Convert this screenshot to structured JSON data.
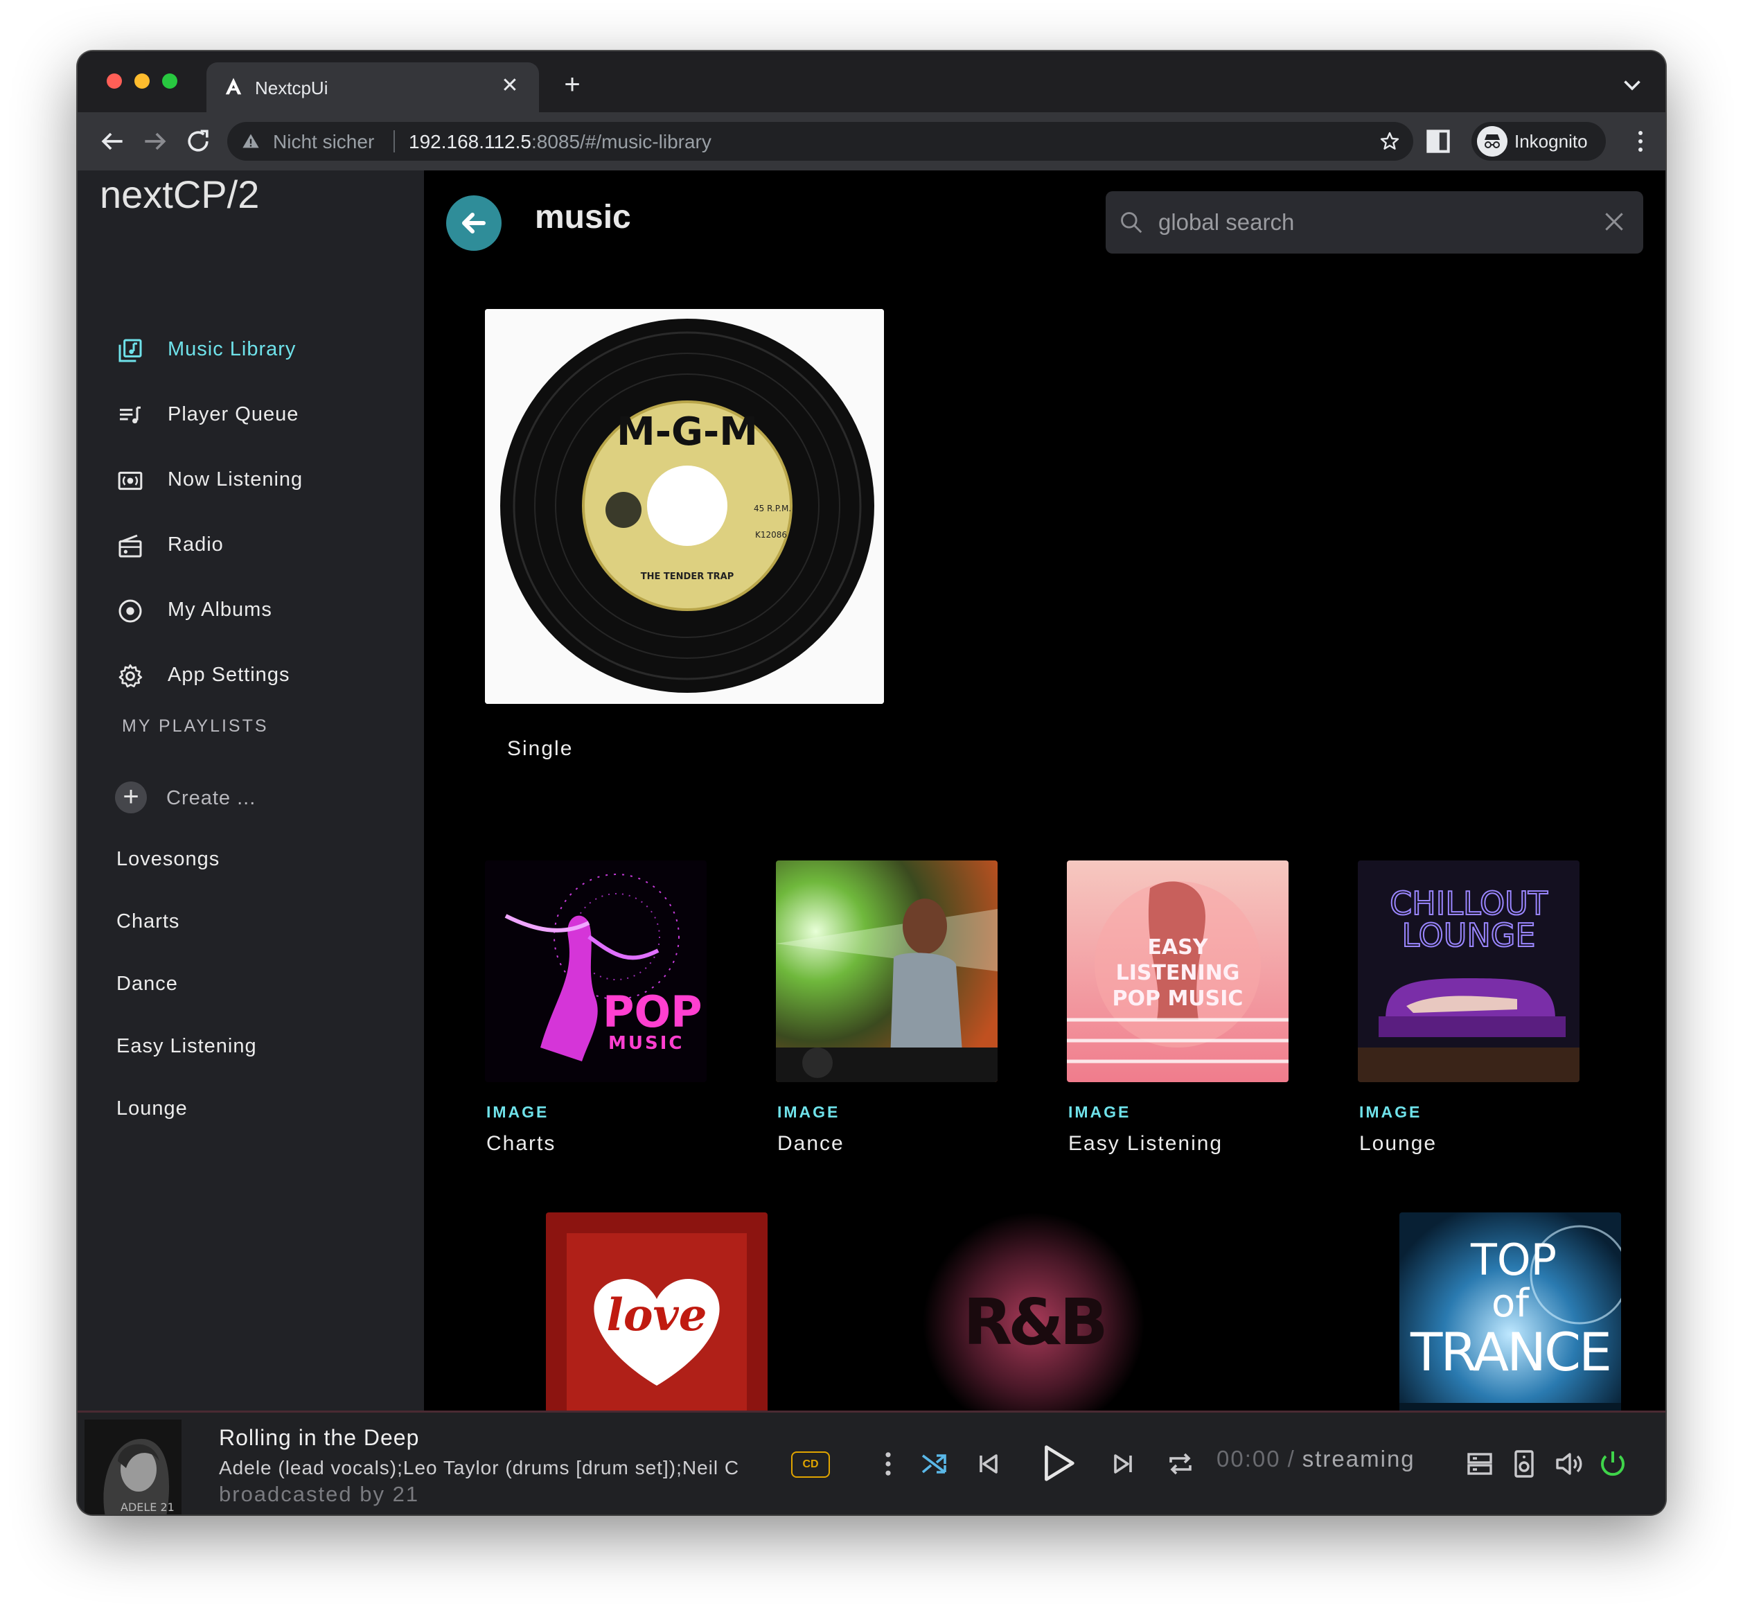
{
  "browser": {
    "tab_title": "NextcpUi",
    "new_tab_symbol": "+",
    "security_label": "Nicht sicher",
    "url_host": "192.168.112.5",
    "url_rest": ":8085/#/music-library",
    "profile_label": "Inkognito"
  },
  "app": {
    "brand": "nextCP/2",
    "nav": [
      {
        "label": "Music Library",
        "icon": "library-music-icon",
        "active": true
      },
      {
        "label": "Player Queue",
        "icon": "queue-music-icon",
        "active": false
      },
      {
        "label": "Now Listening",
        "icon": "now-playing-icon",
        "active": false
      },
      {
        "label": "Radio",
        "icon": "radio-icon",
        "active": false
      },
      {
        "label": "My Albums",
        "icon": "album-disc-icon",
        "active": false
      },
      {
        "label": "App Settings",
        "icon": "gear-icon",
        "active": false
      }
    ],
    "playlists_header": "MY PLAYLISTS",
    "create_label": "Create ...",
    "playlists": [
      "Lovesongs",
      "Charts",
      "Dance",
      "Easy Listening",
      "Lounge"
    ],
    "accent_color": "#6fe2ea"
  },
  "main": {
    "title": "music",
    "search_placeholder": "global search",
    "single": {
      "label": "Single"
    },
    "cards": [
      {
        "kind": "IMAGE",
        "name": "Charts"
      },
      {
        "kind": "IMAGE",
        "name": "Dance"
      },
      {
        "kind": "IMAGE",
        "name": "Easy Listening"
      },
      {
        "kind": "IMAGE",
        "name": "Lounge"
      }
    ]
  },
  "player": {
    "title": "Rolling in the Deep",
    "artist": "Adele (lead vocals);Leo Taylor (drums [drum set]);Neil C",
    "broadcast": "broadcasted by 21",
    "badge": "CD",
    "time": "00:00",
    "separator": "/",
    "status": "streaming",
    "album_art_text": "ADELE 21"
  }
}
